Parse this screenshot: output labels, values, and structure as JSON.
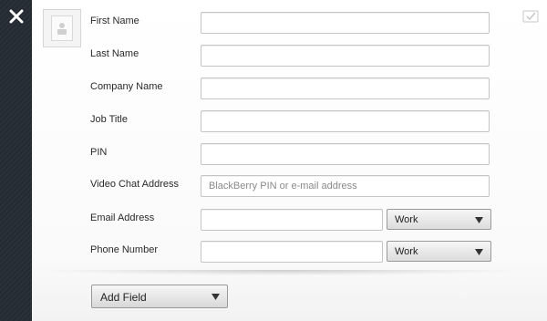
{
  "toolbar": {
    "close_icon": "close-icon",
    "save_icon": "save-check-icon",
    "accent_color": "#2b3138"
  },
  "avatar": {
    "icon": "contact-placeholder-icon"
  },
  "form": {
    "first_name": {
      "label": "First Name",
      "value": "",
      "placeholder": ""
    },
    "last_name": {
      "label": "Last Name",
      "value": "",
      "placeholder": ""
    },
    "company_name": {
      "label": "Company Name",
      "value": "",
      "placeholder": ""
    },
    "job_title": {
      "label": "Job Title",
      "value": "",
      "placeholder": ""
    },
    "pin": {
      "label": "PIN",
      "value": "",
      "placeholder": ""
    },
    "video_chat": {
      "label": "Video Chat Address",
      "value": "",
      "placeholder": "BlackBerry PIN or e-mail address"
    },
    "email": {
      "label": "Email Address",
      "value": "",
      "placeholder": "",
      "type_selected": "Work"
    },
    "phone": {
      "label": "Phone Number",
      "value": "",
      "placeholder": "",
      "type_selected": "Work"
    }
  },
  "add_field": {
    "label": "Add Field"
  }
}
